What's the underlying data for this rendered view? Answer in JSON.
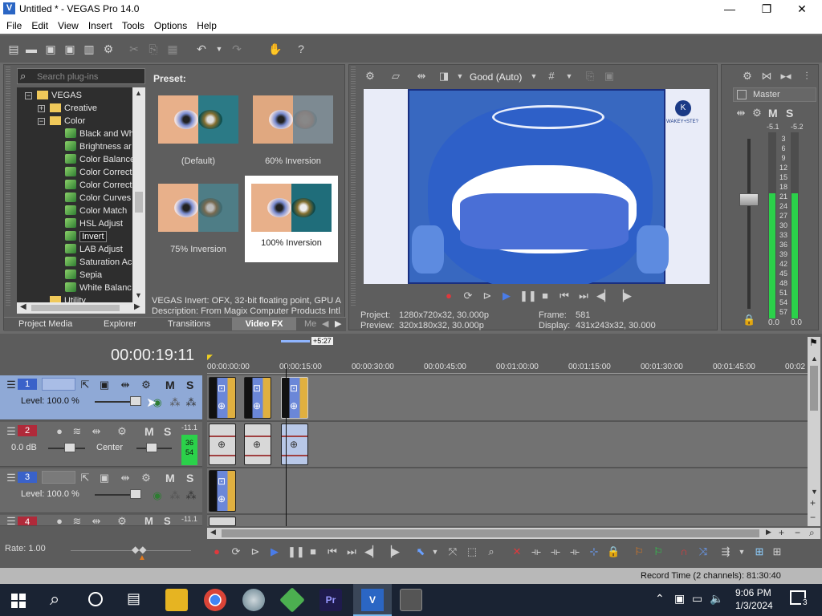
{
  "window": {
    "title": "Untitled * - VEGAS Pro 14.0"
  },
  "menu": [
    "File",
    "Edit",
    "View",
    "Insert",
    "Tools",
    "Options",
    "Help"
  ],
  "plugins": {
    "search_placeholder": "Search plug-ins",
    "tree": [
      "VEGAS",
      "Creative",
      "Color",
      "Black and Wh",
      "Brightness ar",
      "Color Balance",
      "Color Correct",
      "Color Correct",
      "Color Curves",
      "Color Match",
      "HSL Adjust",
      "Invert",
      "LAB Adjust",
      "Saturation Ac",
      "Sepia",
      "White Balanc",
      "Utility"
    ],
    "preset_label": "Preset:",
    "presets": [
      "(Default)",
      "60% Inversion",
      "75% Inversion",
      "100% Inversion"
    ],
    "info1": "VEGAS Invert: OFX, 32-bit floating point, GPU Ac",
    "info2": "Description: From Magix Computer Products Intl.",
    "tabs": [
      "Project Media",
      "Explorer",
      "Transitions",
      "Video FX",
      "Me"
    ]
  },
  "preview": {
    "quality": "Good (Auto)",
    "project_label": "Project:",
    "project": "1280x720x32, 30.000p",
    "preview_label": "Preview:",
    "preview": "320x180x32, 30.000p",
    "frame_label": "Frame:",
    "frame": "581",
    "display_label": "Display:",
    "display": "431x243x32, 30.000",
    "watermark": "WAKEY+STE?"
  },
  "mixer": {
    "master": "Master",
    "m": "M",
    "s": "S",
    "left_peak": "-5.1",
    "right_peak": "-5.2",
    "scale": [
      "3",
      "6",
      "9",
      "12",
      "15",
      "18",
      "21",
      "24",
      "27",
      "30",
      "33",
      "36",
      "39",
      "42",
      "45",
      "48",
      "51",
      "54",
      "57"
    ],
    "left_val": "0.0",
    "right_val": "0.0"
  },
  "timeline": {
    "timecode": "00:00:19:11",
    "marker": "+5:27",
    "ruler": [
      "00:00:00:00",
      "00:00:15:00",
      "00:00:30:00",
      "00:00:45:00",
      "00:01:00:00",
      "00:01:15:00",
      "00:01:30:00",
      "00:01:45:00",
      "00:02"
    ],
    "tracks": [
      {
        "num": "1",
        "level": "Level: 100.0 %"
      },
      {
        "num": "2",
        "db": "0.0 dB",
        "pan": "Center",
        "meter_top": "-11.1",
        "meter_a": "36",
        "meter_b": "54"
      },
      {
        "num": "3",
        "level": "Level: 100.0 %"
      },
      {
        "num": "4",
        "meter_top": "-11.1"
      }
    ],
    "m": "M",
    "s": "S",
    "rate": "Rate: 1.00"
  },
  "status": {
    "record_time": "Record Time (2 channels): 81:30:40"
  },
  "taskbar": {
    "time": "9:06 PM",
    "date": "1/3/2024",
    "notif": "3"
  },
  "colors": {
    "accent_blue": "#3a62c9",
    "track_selected": "#8fa9d6",
    "meter_green": "#2bd14a"
  }
}
